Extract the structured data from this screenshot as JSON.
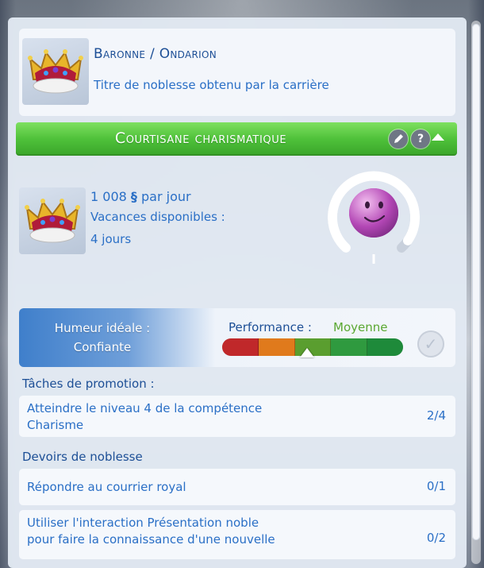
{
  "title_card": {
    "name": "Baronne / Ondarion",
    "description": "Titre de noblesse obtenu par la carrière"
  },
  "career": {
    "title": "Courtisane charismatique",
    "edit_icon": "pencil-icon",
    "help_label": "?",
    "collapse_icon": "chevron-up-icon"
  },
  "job": {
    "pay_amount": "1 008",
    "currency_symbol": "§",
    "pay_suffix": "par jour",
    "vacation_label": "Vacances disponibles :",
    "vacation_days": "4 jours",
    "level_progress": 0.95
  },
  "performance": {
    "mood_label": "Humeur idéale :",
    "mood_value": "Confiante",
    "perf_label": "Performance :",
    "perf_value": "Moyenne",
    "meter_colors": [
      "#c0282a",
      "#e07a1c",
      "#5a9e2f",
      "#2f9a3f",
      "#1e8a3a"
    ],
    "meter_level": 0.47
  },
  "promotion": {
    "heading": "Tâches de promotion :",
    "tasks": [
      {
        "line1": "Atteindre le niveau 4  de la compétence",
        "line2": "Charisme",
        "count": "2/4"
      }
    ]
  },
  "duties": {
    "heading": "Devoirs de noblesse",
    "tasks": [
      {
        "line1": "Répondre au courrier royal",
        "line2": "",
        "count": "0/1"
      },
      {
        "line1": "Utiliser l'interaction Présentation noble",
        "line2": "pour faire la connaissance d'une nouvelle",
        "count": "0/2"
      }
    ]
  }
}
